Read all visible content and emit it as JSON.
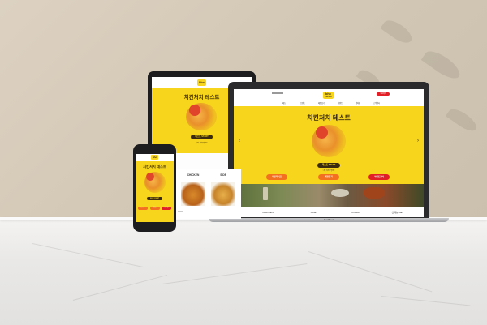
{
  "brand": {
    "logo_text": "bhc",
    "logo_sub": "CHICKEN"
  },
  "hero": {
    "title": "치킨처치 테스트",
    "start_button": "테스트 START",
    "subtitle": "나의 치킨유형은?"
  },
  "laptop": {
    "nav": [
      "메뉴",
      "브랜드",
      "매장찾기",
      "이벤트",
      "멤버쉽",
      "고객센터"
    ],
    "header_button": "주문하기",
    "buttons": [
      "치킨라이프",
      "매장찾기",
      "이벤트참여"
    ],
    "categories": [
      "CHICKEN",
      "SIDE",
      "COMBO",
      "신메뉴 SET"
    ],
    "base_label": "MacBook"
  },
  "phone": {
    "tabs": [
      "CHICKEN",
      "SIDE"
    ],
    "buttons": [
      "치킨라이프",
      "매장찾기",
      "이벤트참여"
    ]
  },
  "colors": {
    "brand_yellow": "#f7d51d",
    "brand_brown": "#3a2a10",
    "accent_orange": "#f37021",
    "accent_red": "#e21e26"
  }
}
